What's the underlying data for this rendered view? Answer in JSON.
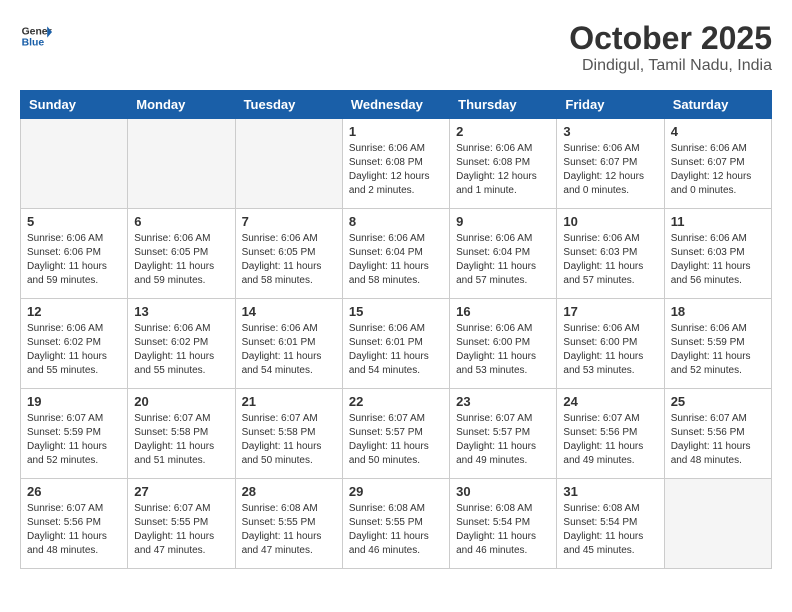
{
  "logo": {
    "line1": "General",
    "line2": "Blue"
  },
  "title": "October 2025",
  "subtitle": "Dindigul, Tamil Nadu, India",
  "days_of_week": [
    "Sunday",
    "Monday",
    "Tuesday",
    "Wednesday",
    "Thursday",
    "Friday",
    "Saturday"
  ],
  "weeks": [
    [
      {
        "day": "",
        "info": ""
      },
      {
        "day": "",
        "info": ""
      },
      {
        "day": "",
        "info": ""
      },
      {
        "day": "1",
        "info": "Sunrise: 6:06 AM\nSunset: 6:08 PM\nDaylight: 12 hours\nand 2 minutes."
      },
      {
        "day": "2",
        "info": "Sunrise: 6:06 AM\nSunset: 6:08 PM\nDaylight: 12 hours\nand 1 minute."
      },
      {
        "day": "3",
        "info": "Sunrise: 6:06 AM\nSunset: 6:07 PM\nDaylight: 12 hours\nand 0 minutes."
      },
      {
        "day": "4",
        "info": "Sunrise: 6:06 AM\nSunset: 6:07 PM\nDaylight: 12 hours\nand 0 minutes."
      }
    ],
    [
      {
        "day": "5",
        "info": "Sunrise: 6:06 AM\nSunset: 6:06 PM\nDaylight: 11 hours\nand 59 minutes."
      },
      {
        "day": "6",
        "info": "Sunrise: 6:06 AM\nSunset: 6:05 PM\nDaylight: 11 hours\nand 59 minutes."
      },
      {
        "day": "7",
        "info": "Sunrise: 6:06 AM\nSunset: 6:05 PM\nDaylight: 11 hours\nand 58 minutes."
      },
      {
        "day": "8",
        "info": "Sunrise: 6:06 AM\nSunset: 6:04 PM\nDaylight: 11 hours\nand 58 minutes."
      },
      {
        "day": "9",
        "info": "Sunrise: 6:06 AM\nSunset: 6:04 PM\nDaylight: 11 hours\nand 57 minutes."
      },
      {
        "day": "10",
        "info": "Sunrise: 6:06 AM\nSunset: 6:03 PM\nDaylight: 11 hours\nand 57 minutes."
      },
      {
        "day": "11",
        "info": "Sunrise: 6:06 AM\nSunset: 6:03 PM\nDaylight: 11 hours\nand 56 minutes."
      }
    ],
    [
      {
        "day": "12",
        "info": "Sunrise: 6:06 AM\nSunset: 6:02 PM\nDaylight: 11 hours\nand 55 minutes."
      },
      {
        "day": "13",
        "info": "Sunrise: 6:06 AM\nSunset: 6:02 PM\nDaylight: 11 hours\nand 55 minutes."
      },
      {
        "day": "14",
        "info": "Sunrise: 6:06 AM\nSunset: 6:01 PM\nDaylight: 11 hours\nand 54 minutes."
      },
      {
        "day": "15",
        "info": "Sunrise: 6:06 AM\nSunset: 6:01 PM\nDaylight: 11 hours\nand 54 minutes."
      },
      {
        "day": "16",
        "info": "Sunrise: 6:06 AM\nSunset: 6:00 PM\nDaylight: 11 hours\nand 53 minutes."
      },
      {
        "day": "17",
        "info": "Sunrise: 6:06 AM\nSunset: 6:00 PM\nDaylight: 11 hours\nand 53 minutes."
      },
      {
        "day": "18",
        "info": "Sunrise: 6:06 AM\nSunset: 5:59 PM\nDaylight: 11 hours\nand 52 minutes."
      }
    ],
    [
      {
        "day": "19",
        "info": "Sunrise: 6:07 AM\nSunset: 5:59 PM\nDaylight: 11 hours\nand 52 minutes."
      },
      {
        "day": "20",
        "info": "Sunrise: 6:07 AM\nSunset: 5:58 PM\nDaylight: 11 hours\nand 51 minutes."
      },
      {
        "day": "21",
        "info": "Sunrise: 6:07 AM\nSunset: 5:58 PM\nDaylight: 11 hours\nand 50 minutes."
      },
      {
        "day": "22",
        "info": "Sunrise: 6:07 AM\nSunset: 5:57 PM\nDaylight: 11 hours\nand 50 minutes."
      },
      {
        "day": "23",
        "info": "Sunrise: 6:07 AM\nSunset: 5:57 PM\nDaylight: 11 hours\nand 49 minutes."
      },
      {
        "day": "24",
        "info": "Sunrise: 6:07 AM\nSunset: 5:56 PM\nDaylight: 11 hours\nand 49 minutes."
      },
      {
        "day": "25",
        "info": "Sunrise: 6:07 AM\nSunset: 5:56 PM\nDaylight: 11 hours\nand 48 minutes."
      }
    ],
    [
      {
        "day": "26",
        "info": "Sunrise: 6:07 AM\nSunset: 5:56 PM\nDaylight: 11 hours\nand 48 minutes."
      },
      {
        "day": "27",
        "info": "Sunrise: 6:07 AM\nSunset: 5:55 PM\nDaylight: 11 hours\nand 47 minutes."
      },
      {
        "day": "28",
        "info": "Sunrise: 6:08 AM\nSunset: 5:55 PM\nDaylight: 11 hours\nand 47 minutes."
      },
      {
        "day": "29",
        "info": "Sunrise: 6:08 AM\nSunset: 5:55 PM\nDaylight: 11 hours\nand 46 minutes."
      },
      {
        "day": "30",
        "info": "Sunrise: 6:08 AM\nSunset: 5:54 PM\nDaylight: 11 hours\nand 46 minutes."
      },
      {
        "day": "31",
        "info": "Sunrise: 6:08 AM\nSunset: 5:54 PM\nDaylight: 11 hours\nand 45 minutes."
      },
      {
        "day": "",
        "info": ""
      }
    ]
  ]
}
